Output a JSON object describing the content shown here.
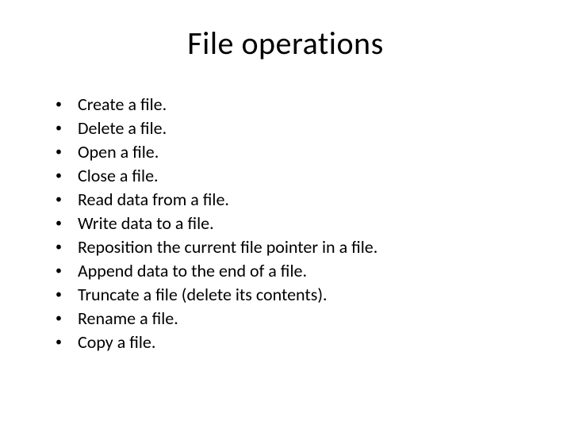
{
  "title": "File operations",
  "items": [
    "Create a file.",
    "Delete a file.",
    "Open a file.",
    "Close a file.",
    "Read data from a file.",
    "Write data to a file.",
    "Reposition the current file pointer in a file.",
    "Append data to the end of a file.",
    "Truncate a file (delete its contents).",
    "Rename a file.",
    "Copy a file."
  ]
}
